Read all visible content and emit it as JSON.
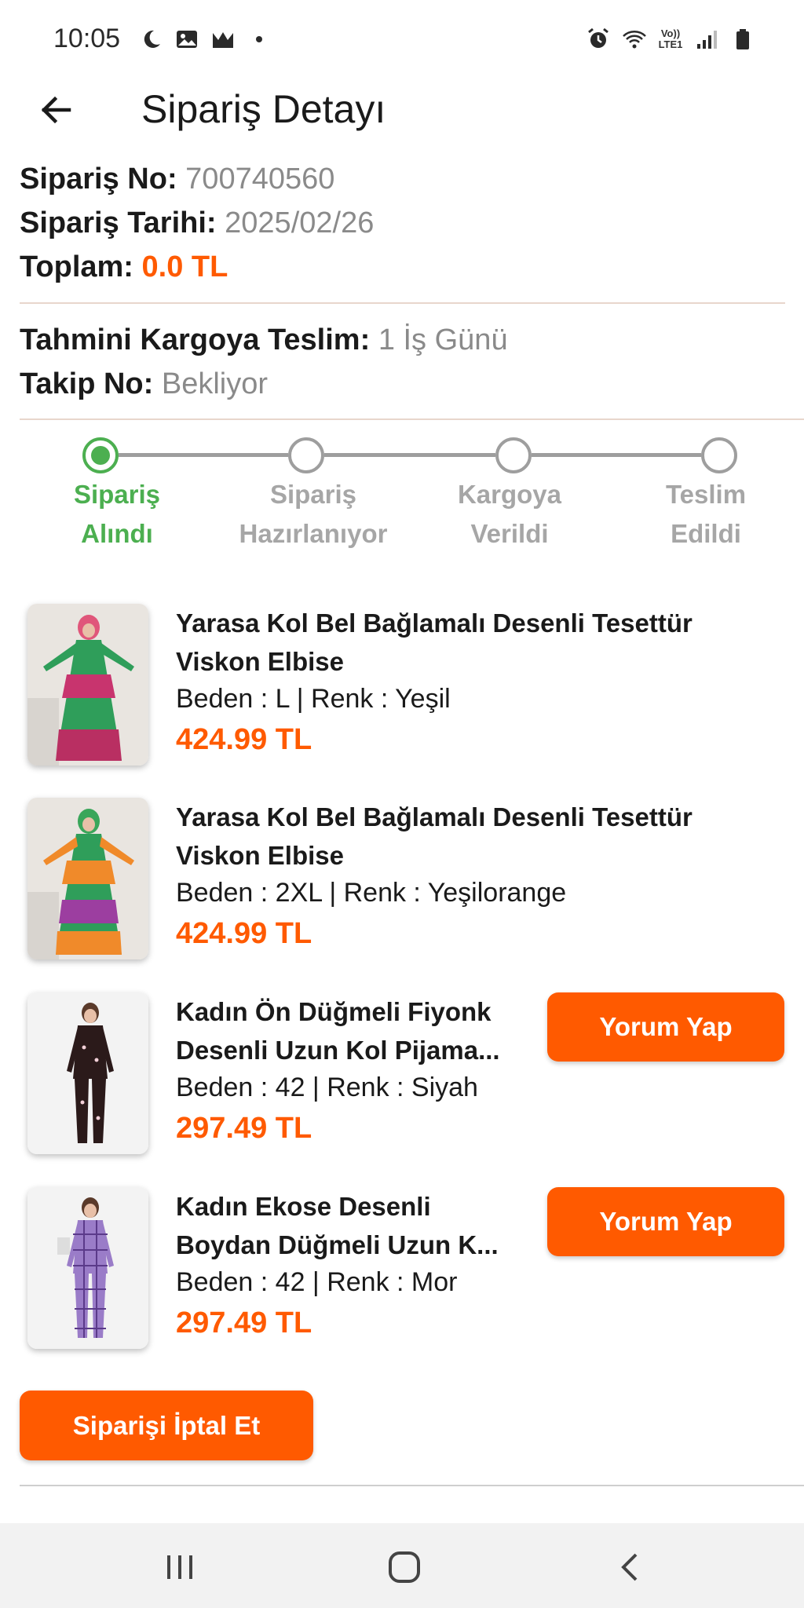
{
  "status_bar": {
    "time": "10:05",
    "left_icons": [
      "moon-icon",
      "image-icon",
      "gallery-icon",
      "dot-icon"
    ],
    "right_icons": [
      "alarm-icon",
      "wifi-icon",
      "volte-icon",
      "signal-icon",
      "battery-icon"
    ],
    "network_label": "Vo)) LTE1"
  },
  "header": {
    "title": "Sipariş Detayı",
    "back_icon": "arrow-left-icon"
  },
  "order": {
    "number_label": "Sipariş No:",
    "number_value": "700740560",
    "date_label": "Sipariş Tarihi:",
    "date_value": "2025/02/26",
    "total_label": "Toplam:",
    "total_value": "0.0 TL",
    "delivery_label": "Tahmini Kargoya Teslim:",
    "delivery_value": "1 İş Günü",
    "tracking_label": "Takip No:",
    "tracking_value": "Bekliyor"
  },
  "steps": [
    {
      "line1": "Sipariş",
      "line2": "Alındı",
      "active": true
    },
    {
      "line1": "Sipariş",
      "line2": "Hazırlanıyor",
      "active": false
    },
    {
      "line1": "Kargoya",
      "line2": "Verildi",
      "active": false
    },
    {
      "line1": "Teslim",
      "line2": "Edildi",
      "active": false
    }
  ],
  "products": [
    {
      "name_line1": "Yarasa Kol Bel Bağlamalı Desenli Tesettür",
      "name_line2": "Viskon Elbise",
      "attributes": "Beden : L | Renk : Yeşil",
      "price": "424.99 TL",
      "review_label": ""
    },
    {
      "name_line1": "Yarasa Kol Bel Bağlamalı Desenli Tesettür",
      "name_line2": "Viskon Elbise",
      "attributes": "Beden : 2XL | Renk : Yeşilorange",
      "price": "424.99 TL",
      "review_label": ""
    },
    {
      "name_line1": "Kadın Ön Düğmeli Fiyonk",
      "name_line2": "Desenli Uzun Kol Pijama...",
      "attributes": "Beden : 42 | Renk : Siyah",
      "price": "297.49 TL",
      "review_label": "Yorum Yap"
    },
    {
      "name_line1": "Kadın Ekose Desenli",
      "name_line2": "Boydan Düğmeli Uzun K...",
      "attributes": "Beden : 42 | Renk : Mor",
      "price": "297.49 TL",
      "review_label": "Yorum Yap"
    }
  ],
  "actions": {
    "cancel_label": "Siparişi İptal Et"
  },
  "nav_bar": {
    "icons": [
      "recent-apps-icon",
      "home-icon",
      "back-icon"
    ]
  },
  "colors": {
    "accent": "#ff5a00",
    "active_step": "#4caf50",
    "inactive_step": "#9e9e9e"
  }
}
